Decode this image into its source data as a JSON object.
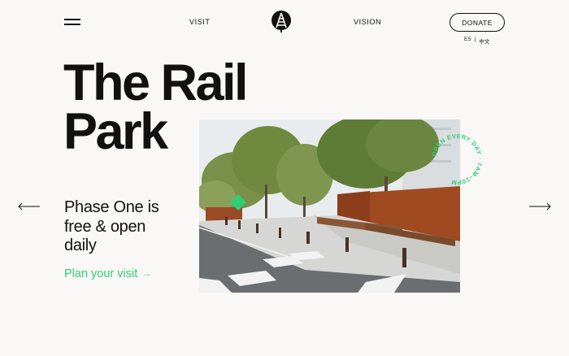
{
  "header": {
    "menu_icon": "hamburger-icon",
    "nav_visit": "VISIT",
    "nav_vision": "VISION",
    "logo_icon": "rail-park-logo-icon",
    "donate_label": "DONATE",
    "languages": [
      "ES",
      "中文"
    ],
    "lang_separator": "|"
  },
  "hero": {
    "title_line1": "The Rail",
    "title_line2": "Park",
    "subtitle_line1": "Phase One is",
    "subtitle_line2": "free & open",
    "subtitle_line3": "daily",
    "cta_label": "Plan your visit",
    "cta_arrow": "→",
    "badge_text": "OPEN EVERY DAY · 7AM–10PM",
    "image_alt": "Rail Park plaza with trees, bollards and crosswalk"
  },
  "carousel": {
    "prev_icon": "arrow-left-icon",
    "next_icon": "arrow-right-icon"
  },
  "colors": {
    "background": "#f9f8f6",
    "accent_green": "#2fcf76",
    "text": "#111111"
  }
}
